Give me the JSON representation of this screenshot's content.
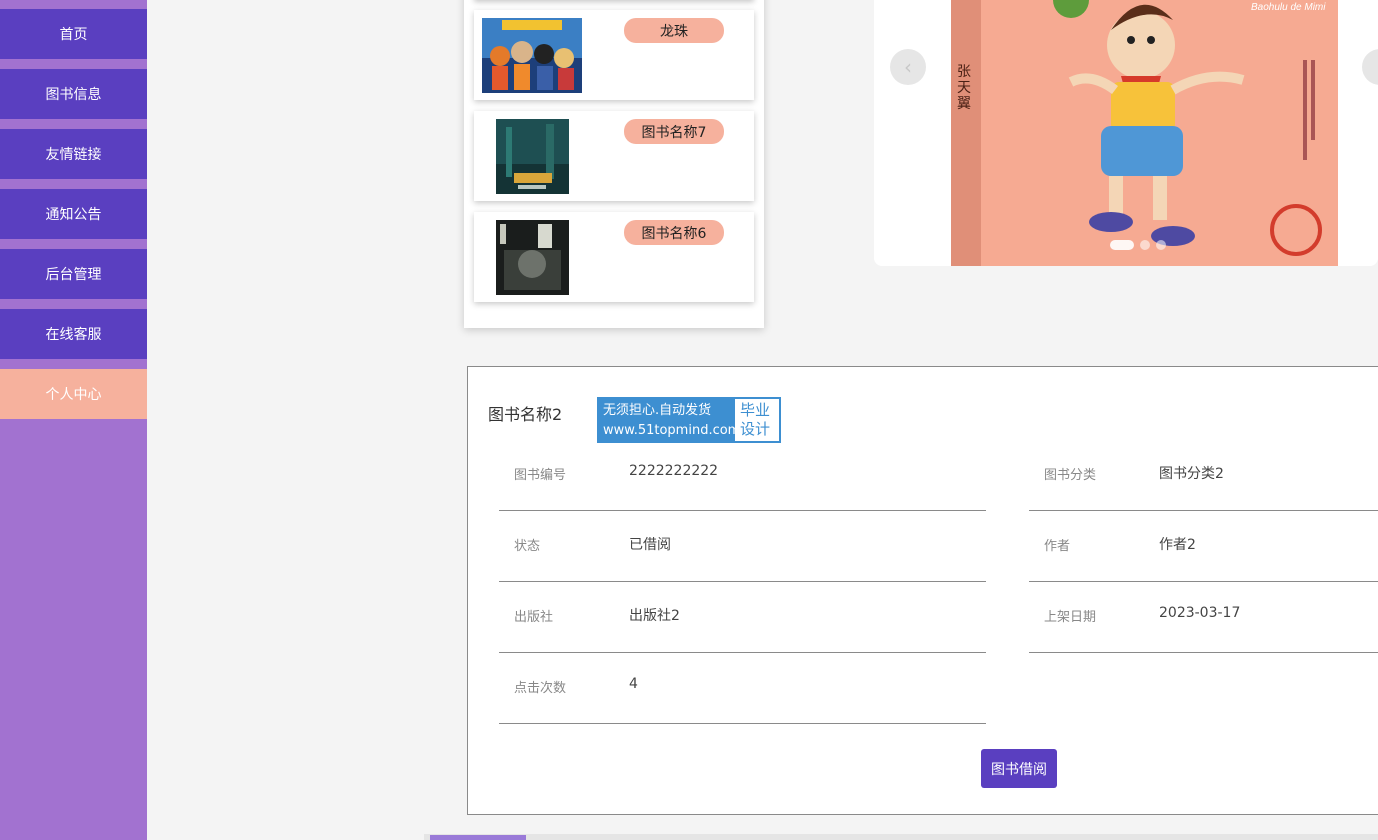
{
  "sidebar": {
    "items": [
      {
        "label": "首页"
      },
      {
        "label": "图书信息"
      },
      {
        "label": "友情链接"
      },
      {
        "label": "通知公告"
      },
      {
        "label": "后台管理"
      },
      {
        "label": "在线客服"
      },
      {
        "label": "个人中心",
        "active": true
      }
    ]
  },
  "book_list": [
    {
      "name": "龙珠"
    },
    {
      "name": "图书名称7"
    },
    {
      "name": "图书名称6"
    }
  ],
  "carousel": {
    "prev_icon": "‹",
    "cover_subtitle": "Baohulu de Mimi",
    "cover_author": "张天翼",
    "slide_count": 3,
    "active_slide": 1
  },
  "detail": {
    "title": "图书名称2",
    "badge": {
      "line1": "无须担心.自动发货",
      "line2": "www.51topmind.com",
      "right1": "毕业",
      "right2": "设计"
    },
    "fields": {
      "book_no": {
        "label": "图书编号",
        "value": "2222222222"
      },
      "category": {
        "label": "图书分类",
        "value": "图书分类2"
      },
      "status": {
        "label": "状态",
        "value": "已借阅"
      },
      "author": {
        "label": "作者",
        "value": "作者2"
      },
      "publisher": {
        "label": "出版社",
        "value": "出版社2"
      },
      "shelf_date": {
        "label": "上架日期",
        "value": "2023-03-17"
      },
      "clicks": {
        "label": "点击次数",
        "value": "4"
      }
    },
    "borrow_label": "图书借阅"
  },
  "colors": {
    "primary": "#5a3fc0",
    "sidebar_bg": "#a272d0",
    "accent": "#f6b19d",
    "badge_blue": "#3d8fd1"
  }
}
